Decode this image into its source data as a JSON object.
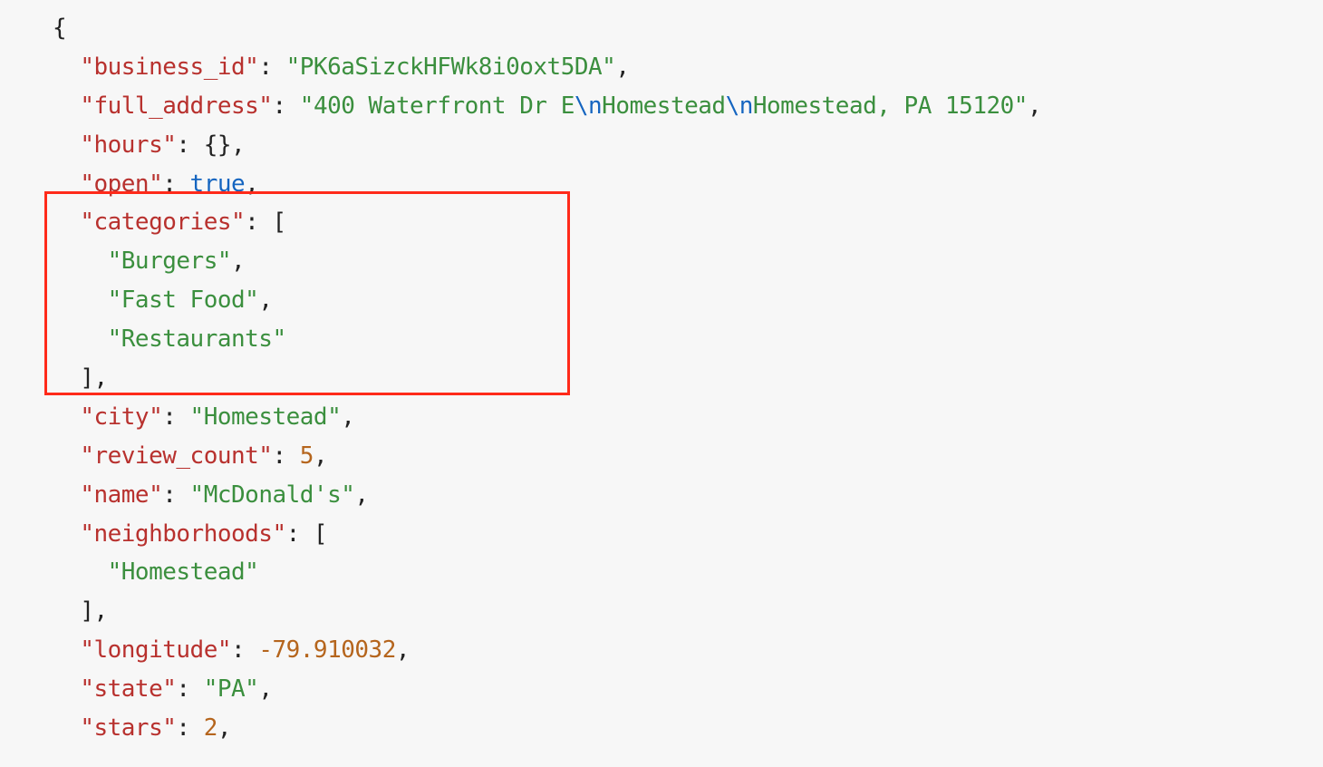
{
  "json": {
    "business_id": "PK6aSizckHFWk8i0oxt5DA",
    "full_address": {
      "segments": [
        "400 Waterfront Dr E",
        "\\n",
        "Homestead",
        "\\n",
        "Homestead, PA 15120"
      ]
    },
    "hours": "{}",
    "open": "true",
    "categories": [
      "Burgers",
      "Fast Food",
      "Restaurants"
    ],
    "city": "Homestead",
    "review_count": "5",
    "name": "McDonald's",
    "neighborhoods": [
      "Homestead"
    ],
    "longitude": "-79.910032",
    "state": "PA",
    "stars": "2"
  },
  "keys": {
    "business_id": "business_id",
    "full_address": "full_address",
    "hours": "hours",
    "open": "open",
    "categories": "categories",
    "city": "city",
    "review_count": "review_count",
    "name": "name",
    "neighborhoods": "neighborhoods",
    "longitude": "longitude",
    "state": "state",
    "stars": "stars"
  }
}
